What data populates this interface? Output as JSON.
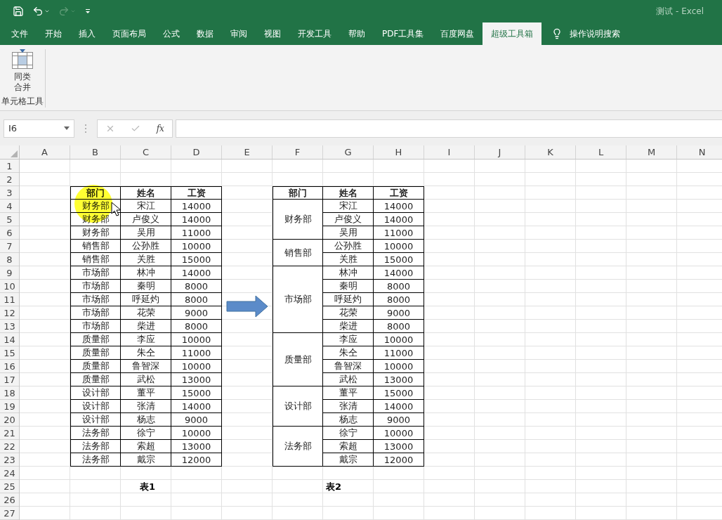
{
  "window": {
    "title": "测试 - Excel"
  },
  "quick_access": [
    {
      "kind": "save",
      "disabled": false
    },
    {
      "kind": "undo",
      "disabled": false
    },
    {
      "kind": "redo",
      "disabled": true
    },
    {
      "kind": "customize",
      "disabled": false
    }
  ],
  "ribbon_tabs": [
    {
      "label": "文件",
      "selected": false
    },
    {
      "label": "开始",
      "selected": false
    },
    {
      "label": "插入",
      "selected": false
    },
    {
      "label": "页面布局",
      "selected": false
    },
    {
      "label": "公式",
      "selected": false
    },
    {
      "label": "数据",
      "selected": false
    },
    {
      "label": "审阅",
      "selected": false
    },
    {
      "label": "视图",
      "selected": false
    },
    {
      "label": "开发工具",
      "selected": false
    },
    {
      "label": "帮助",
      "selected": false
    },
    {
      "label": "PDF工具集",
      "selected": false
    },
    {
      "label": "百度网盘",
      "selected": false
    },
    {
      "label": "超级工具箱",
      "selected": true
    }
  ],
  "tell_me": {
    "label": "操作说明搜索"
  },
  "ribbon": {
    "groups": [
      {
        "label": "单元格工具",
        "buttons": [
          {
            "label": "同类合并"
          }
        ]
      }
    ]
  },
  "formula_bar": {
    "name_box": "I6",
    "function_button": "fx"
  },
  "sheet": {
    "columns": [
      "A",
      "B",
      "C",
      "D",
      "E",
      "F",
      "G",
      "H",
      "I",
      "J",
      "K",
      "L",
      "M",
      "N"
    ],
    "rows": [
      "1",
      "2",
      "3",
      "4",
      "5",
      "6",
      "7",
      "8",
      "9",
      "10",
      "11",
      "12",
      "13",
      "14",
      "15",
      "16",
      "17",
      "18",
      "19",
      "20",
      "21",
      "22",
      "23",
      "24",
      "25",
      "26",
      "27"
    ],
    "tables": [
      {
        "kind": "flat",
        "header": [
          "部门",
          "姓名",
          "工资"
        ],
        "rows": [
          [
            "财务部",
            "宋江",
            "14000"
          ],
          [
            "财务部",
            "卢俊义",
            "14000"
          ],
          [
            "财务部",
            "吴用",
            "11000"
          ],
          [
            "销售部",
            "公孙胜",
            "10000"
          ],
          [
            "销售部",
            "关胜",
            "15000"
          ],
          [
            "市场部",
            "林冲",
            "14000"
          ],
          [
            "市场部",
            "秦明",
            "8000"
          ],
          [
            "市场部",
            "呼延灼",
            "8000"
          ],
          [
            "市场部",
            "花荣",
            "9000"
          ],
          [
            "市场部",
            "柴进",
            "8000"
          ],
          [
            "质量部",
            "李应",
            "10000"
          ],
          [
            "质量部",
            "朱仝",
            "11000"
          ],
          [
            "质量部",
            "鲁智深",
            "10000"
          ],
          [
            "质量部",
            "武松",
            "13000"
          ],
          [
            "设计部",
            "董平",
            "15000"
          ],
          [
            "设计部",
            "张清",
            "14000"
          ],
          [
            "设计部",
            "杨志",
            "9000"
          ],
          [
            "法务部",
            "徐宁",
            "10000"
          ],
          [
            "法务部",
            "索超",
            "13000"
          ],
          [
            "法务部",
            "戴宗",
            "12000"
          ]
        ],
        "caption": "表1"
      },
      {
        "kind": "grouped",
        "header": [
          "部门",
          "姓名",
          "工资"
        ],
        "groups": [
          {
            "department": "财务部",
            "members": [
              [
                "宋江",
                "14000"
              ],
              [
                "卢俊义",
                "14000"
              ],
              [
                "吴用",
                "11000"
              ]
            ]
          },
          {
            "department": "销售部",
            "members": [
              [
                "公孙胜",
                "10000"
              ],
              [
                "关胜",
                "15000"
              ]
            ]
          },
          {
            "department": "市场部",
            "members": [
              [
                "林冲",
                "14000"
              ],
              [
                "秦明",
                "8000"
              ],
              [
                "呼延灼",
                "8000"
              ],
              [
                "花荣",
                "9000"
              ],
              [
                "柴进",
                "8000"
              ]
            ]
          },
          {
            "department": "质量部",
            "members": [
              [
                "李应",
                "10000"
              ],
              [
                "朱仝",
                "11000"
              ],
              [
                "鲁智深",
                "10000"
              ],
              [
                "武松",
                "13000"
              ]
            ]
          },
          {
            "department": "设计部",
            "members": [
              [
                "董平",
                "15000"
              ],
              [
                "张清",
                "14000"
              ],
              [
                "杨志",
                "9000"
              ]
            ]
          },
          {
            "department": "法务部",
            "members": [
              [
                "徐宁",
                "10000"
              ],
              [
                "索超",
                "13000"
              ],
              [
                "戴宗",
                "12000"
              ]
            ]
          }
        ],
        "caption": "表2"
      }
    ]
  }
}
